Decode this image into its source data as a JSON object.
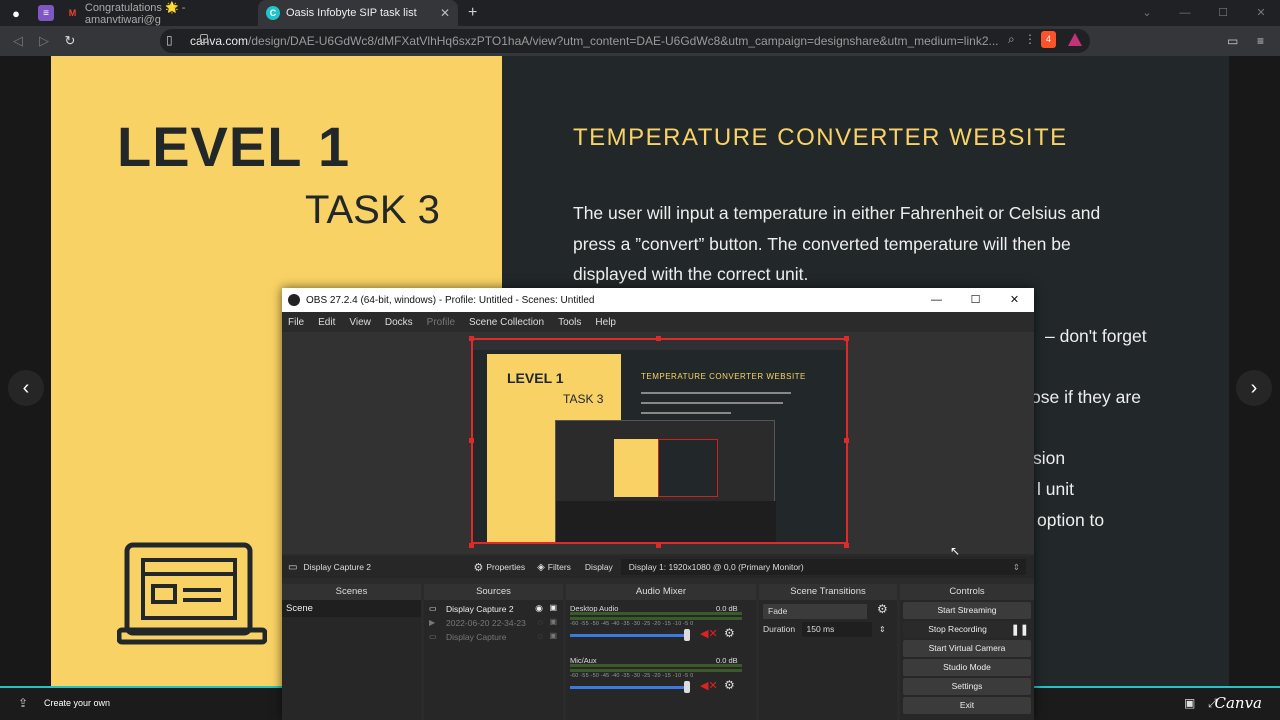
{
  "browser": {
    "tabs": [
      {
        "label": "Congratulations 🌟 - amanvtiwari@g",
        "icon": "gmail-icon"
      },
      {
        "label": "Oasis Infobyte SIP task list",
        "icon": "canva-icon"
      }
    ],
    "new_tab": "+",
    "url_domain": "canva.com",
    "url_path": "/design/DAE-U6GdWc8/dMFXatVlhHq6sxzPTO1haA/view?utm_content=DAE-U6GdWc8&utm_campaign=designshare&utm_medium=link2...",
    "brave_count": "4"
  },
  "slide": {
    "level": "LEVEL 1",
    "task": "TASK 3",
    "title": "TEMPERATURE CONVERTER WEBSITE",
    "body": "The user will input a temperature in either Fahrenheit or Celsius and press a ”convert” button. The converted temperature will then be displayed with the correct unit.",
    "frag1": "– don't forget",
    "frag2": "ose if they are",
    "frag3": "sion",
    "frag4": "l unit",
    "frag5": "option to"
  },
  "canva": {
    "create_label": "Create your own",
    "logo": "Canva"
  },
  "obs": {
    "title": "OBS 27.2.4 (64-bit, windows) - Profile: Untitled - Scenes: Untitled",
    "menu": [
      "File",
      "Edit",
      "View",
      "Docks",
      "Profile",
      "Scene Collection",
      "Tools",
      "Help"
    ],
    "preview": {
      "level": "LEVEL 1",
      "task": "TASK 3",
      "title": "TEMPERATURE CONVERTER WEBSITE"
    },
    "source_bar": {
      "source": "Display Capture 2",
      "properties": "Properties",
      "filters": "Filters",
      "display_label": "Display",
      "display_value": "Display 1: 1920x1080 @ 0,0 (Primary Monitor)"
    },
    "docks": {
      "scenes": {
        "header": "Scenes",
        "items": [
          "Scene"
        ]
      },
      "sources": {
        "header": "Sources",
        "items": [
          {
            "label": "Display Capture 2",
            "dim": false,
            "icon": "monitor-icon"
          },
          {
            "label": "2022-06-20 22-34-23",
            "dim": true,
            "icon": "play-icon"
          },
          {
            "label": "Display Capture",
            "dim": true,
            "icon": "monitor-icon"
          }
        ]
      },
      "mixer": {
        "header": "Audio Mixer",
        "channels": [
          {
            "name": "Desktop Audio",
            "db": "0.0 dB"
          },
          {
            "name": "Mic/Aux",
            "db": "0.0 dB"
          }
        ],
        "scale": "-60 -55 -50 -45 -40 -35 -30 -25 -20 -15 -10 -5 0"
      },
      "transitions": {
        "header": "Scene Transitions",
        "type": "Fade",
        "duration_label": "Duration",
        "duration_value": "150 ms"
      },
      "controls": {
        "header": "Controls",
        "buttons": [
          "Start Streaming",
          "Stop Recording",
          "Start Virtual Camera",
          "Studio Mode",
          "Settings",
          "Exit"
        ]
      }
    }
  }
}
